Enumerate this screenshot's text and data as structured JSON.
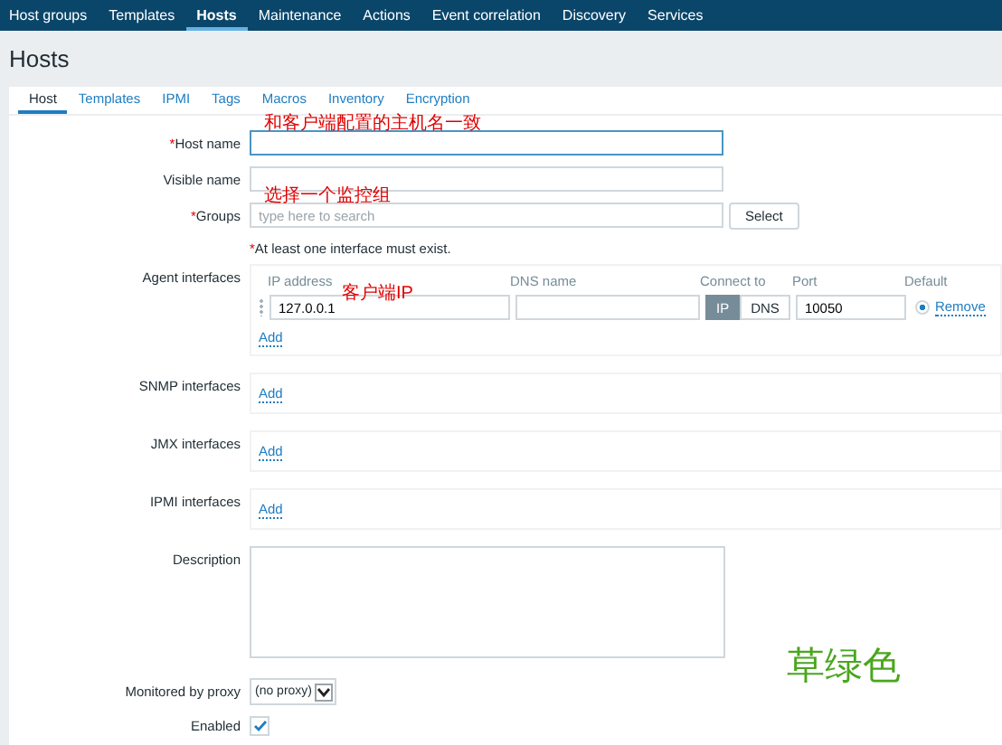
{
  "nav": [
    {
      "label": "Host groups",
      "selected": false
    },
    {
      "label": "Templates",
      "selected": false
    },
    {
      "label": "Hosts",
      "selected": true
    },
    {
      "label": "Maintenance",
      "selected": false
    },
    {
      "label": "Actions",
      "selected": false
    },
    {
      "label": "Event correlation",
      "selected": false
    },
    {
      "label": "Discovery",
      "selected": false
    },
    {
      "label": "Services",
      "selected": false
    }
  ],
  "title": "Hosts",
  "tabs": [
    {
      "label": "Host",
      "selected": true
    },
    {
      "label": "Templates",
      "selected": false
    },
    {
      "label": "IPMI",
      "selected": false
    },
    {
      "label": "Tags",
      "selected": false
    },
    {
      "label": "Macros",
      "selected": false
    },
    {
      "label": "Inventory",
      "selected": false
    },
    {
      "label": "Encryption",
      "selected": false
    }
  ],
  "host_name": {
    "label": "Host name",
    "required_mark": "*",
    "annotation": "和客户端配置的主机名一致"
  },
  "visible_name": {
    "label": "Visible name"
  },
  "groups": {
    "label": "Groups",
    "required_mark": "*",
    "placeholder": "type here to search",
    "button": "Select",
    "annotation": "选择一个监控组"
  },
  "note": {
    "text": "At least one interface must exist.",
    "required_mark": "*"
  },
  "agent_interfaces": {
    "label": "Agent interfaces",
    "columns": [
      "IP address",
      "DNS name",
      "Connect to",
      "Port",
      "Default"
    ],
    "rows": [
      {
        "ip": "127.0.0.1",
        "dns": "",
        "connect": [
          {
            "label": "IP",
            "selected": true
          },
          {
            "label": "DNS",
            "selected": false
          }
        ],
        "port": "10050",
        "default": true,
        "remove": "Remove",
        "annotation": "客户端IP"
      }
    ],
    "add": "Add"
  },
  "other_interfaces": [
    {
      "label": "SNMP interfaces",
      "add": "Add"
    },
    {
      "label": "JMX interfaces",
      "add": "Add"
    },
    {
      "label": "IPMI interfaces",
      "add": "Add"
    }
  ],
  "description": {
    "label": "Description"
  },
  "proxy": {
    "label": "Monitored by proxy",
    "value": "(no proxy)"
  },
  "enabled": {
    "label": "Enabled",
    "checked": true
  },
  "side_note": {
    "text": "草绿色",
    "kind": "green"
  }
}
